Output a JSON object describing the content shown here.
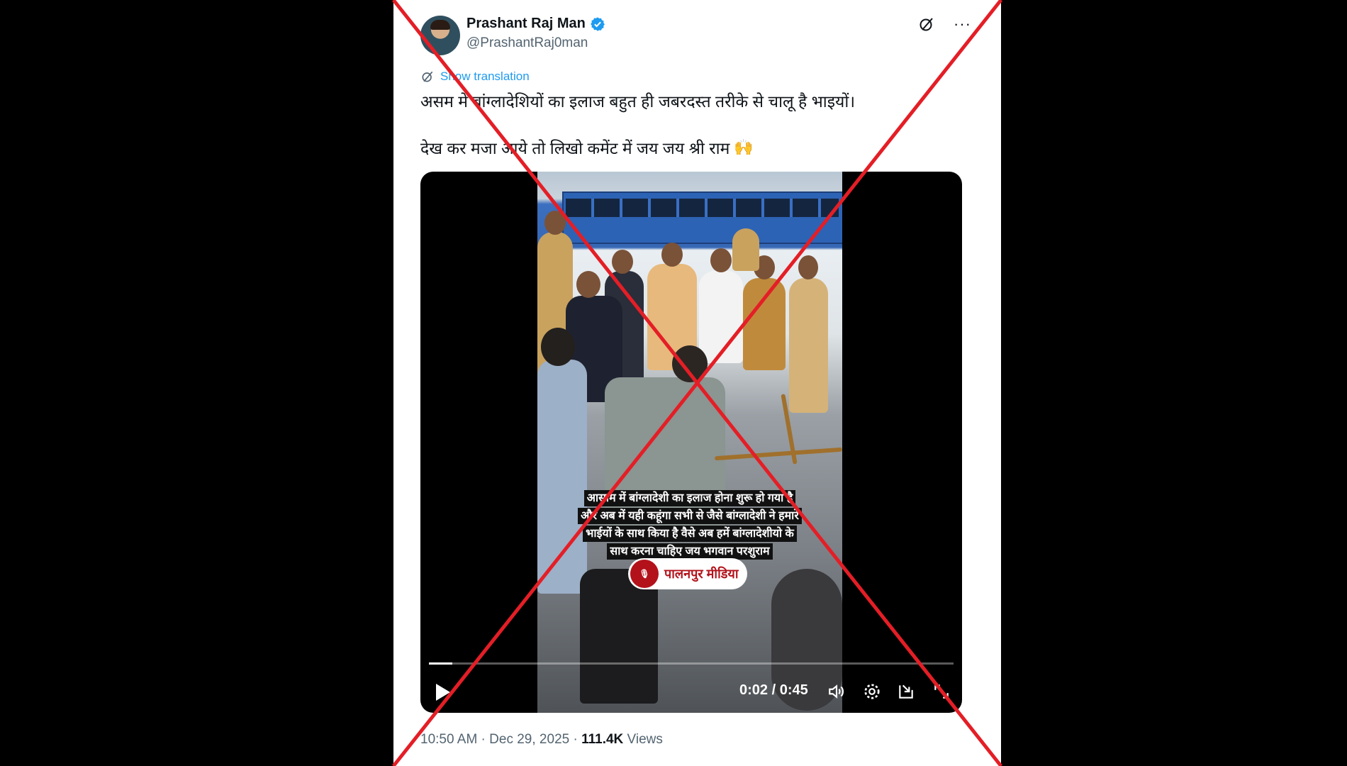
{
  "post": {
    "author_name": "Prashant Raj Man",
    "handle": "@PrashantRaj0man",
    "show_translation": "Show translation",
    "text_line1": "असम में बांग्लादेशियों का इलाज बहुत ही जबरदस्त तरीके से चालू है भाइयों।",
    "text_line2": "देख कर मजा आये तो लिखो कमेंट में जय जय श्री राम",
    "emoji_icon": "raised-hands-icon"
  },
  "video": {
    "caption_lines": [
      "आसाम में बांग्लादेशी का इलाज होना शुरू हो गया है",
      "और अब में यही कहूंगा सभी से जैसे बांग्लादेशी ने हमारे",
      "भाईयों के साथ किया है वैसे अब हमें बांग्लादेशीयो के",
      "साथ करना चाहिए जय भगवान परशुराम"
    ],
    "watermark": "पालनपुर मीडिया",
    "elapsed": "0:02",
    "duration": "0:45",
    "progress_fraction": 0.044
  },
  "footer": {
    "time": "10:50 AM",
    "date": "Dec 29, 2025",
    "views_count": "111.4K",
    "views_label": "Views"
  },
  "colors": {
    "accent": "#1d9bf0",
    "cross": "#e41e26",
    "muted": "#536471"
  }
}
